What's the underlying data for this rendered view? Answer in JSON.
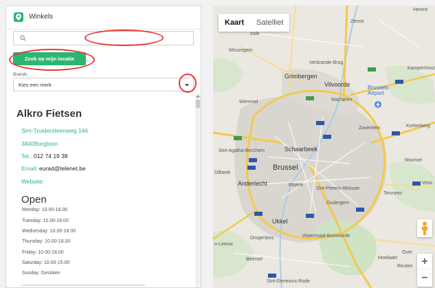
{
  "panel": {
    "title": "Winkels",
    "search_placeholder": "",
    "locate_button": "Zoek op mijn locatie",
    "brands_label": "Brands",
    "brand_select_value": "Kies een merk"
  },
  "store": {
    "name": "Alkro Fietsen",
    "street": "Sint-Truidersteenweg 146",
    "city": "3840Borgloon",
    "tel_label": "Tel.:",
    "tel_value": "012 74 19 38",
    "email_label": "Email:",
    "email_value": "eurad@telenet.be",
    "website_label": "Website:",
    "status": "Open",
    "hours": [
      "Monday: 10.00-18.00",
      "Tuesday: 10.00-18.00",
      "Wednesday: 10.00-18.00",
      "Thursday: 10.00-18.00",
      "Friday: 10.00-18.00",
      "Saturday: 10.00-15.00",
      "Sunday: Gesloten"
    ]
  },
  "map": {
    "tabs": [
      "Kaart",
      "Satelliet"
    ],
    "labels": {
      "herent": "Herent",
      "zemst": "Zemst",
      "meuzegem": "Meuzegem",
      "verbrande": "Verbrande-Brug",
      "grimbergen": "Grimbergen",
      "vilvoorde": "Vilvoorde",
      "machelen": "Machelen",
      "airport": "Brussels Airport",
      "kampenhout": "Kampenhout",
      "wemmel": "Wemmel",
      "zaventem": "Zaventem",
      "kortenberg": "Kortenberg",
      "sint_agatha": "Sint-Agatha-Berchem",
      "schaarbeek": "Schaarbeek",
      "dilbeek": "Dilbeek",
      "brussel": "Brussel",
      "moorsel": "Moorsel",
      "anderlecht": "Anderlecht",
      "elsene": "Elsene",
      "sint_pieters": "Sint-Pieters-Woluwe",
      "tervuren": "Tervuren",
      "oudergem": "Oudergem",
      "vossem": "Voss",
      "ukkel": "Ukkel",
      "drogenbos": "Drogenbos",
      "watermaal": "Watermaal-Bosvoorde",
      "hoeilaart": "Hoeilaart",
      "overijse": "Over",
      "beersel": "Beersel",
      "reuten": "Reuten",
      "sint_genesius": "Sint-Genesius-Rode",
      "leeuw": "n-Leeuw",
      "inde": "Inde"
    },
    "zoom_in": "+",
    "zoom_out": "−"
  }
}
